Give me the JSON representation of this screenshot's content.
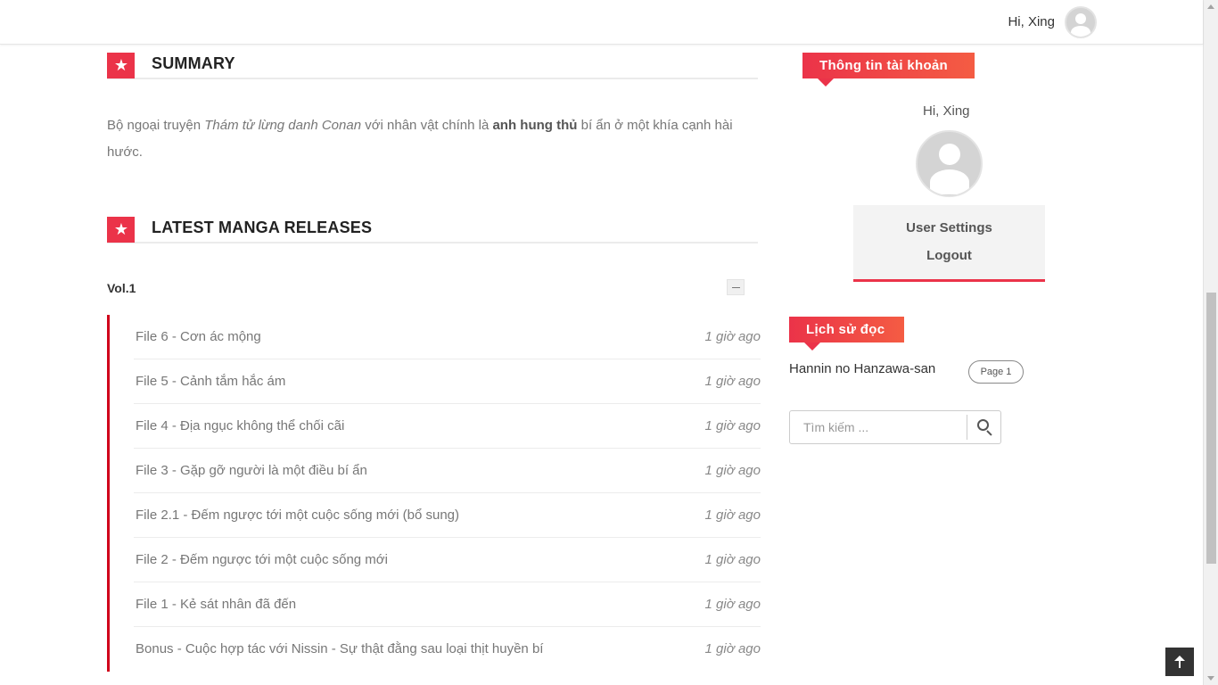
{
  "header": {
    "greeting": "Hi, Xing"
  },
  "summary": {
    "heading": "SUMMARY",
    "text_prefix": "Bộ ngoại truyện ",
    "text_title": "Thám tử lừng danh Conan",
    "text_mid": " với nhân vật chính là ",
    "text_bold": "anh hung thủ",
    "text_suffix": " bí ẩn ở một khía cạnh hài hước."
  },
  "releases": {
    "heading": "LATEST MANGA RELEASES",
    "volume": "Vol.1",
    "chapters": [
      {
        "name": "File 6 - Cơn ác mộng",
        "time": "1 giờ ago"
      },
      {
        "name": "File 5 - Cảnh tắm hắc ám",
        "time": "1 giờ ago"
      },
      {
        "name": "File 4 - Địa ngục không thể chối cãi",
        "time": "1 giờ ago"
      },
      {
        "name": "File 3 - Gặp gỡ người là một điều bí ẩn",
        "time": "1 giờ ago"
      },
      {
        "name": "File 2.1 - Đếm ngược tới một cuộc sống mới (bổ sung)",
        "time": "1 giờ ago"
      },
      {
        "name": "File 2 - Đếm ngược tới một cuộc sống mới",
        "time": "1 giờ ago"
      },
      {
        "name": "File 1 - Kẻ sát nhân đã đến",
        "time": "1 giờ ago"
      },
      {
        "name": "Bonus - Cuộc hợp tác với Nissin - Sự thật đằng sau loại thịt huyền bí",
        "time": "1 giờ ago"
      }
    ]
  },
  "sidebar": {
    "account_heading": "Thông tin tài khoản",
    "greeting": "Hi, Xing",
    "user_settings": "User Settings",
    "logout": "Logout",
    "history_heading": "Lịch sử đọc",
    "history_item": "Hannin no Hanzawa-san",
    "history_page": "Page 1",
    "search_placeholder": "Tìm kiếm ..."
  },
  "icons": [
    "star-icon",
    "user-avatar-icon",
    "search-icon",
    "arrow-up-icon",
    "collapse-icon"
  ],
  "colors": {
    "accent": "#eb3349",
    "accent_end": "#f45c43",
    "chapter_border": "#d0021b"
  }
}
